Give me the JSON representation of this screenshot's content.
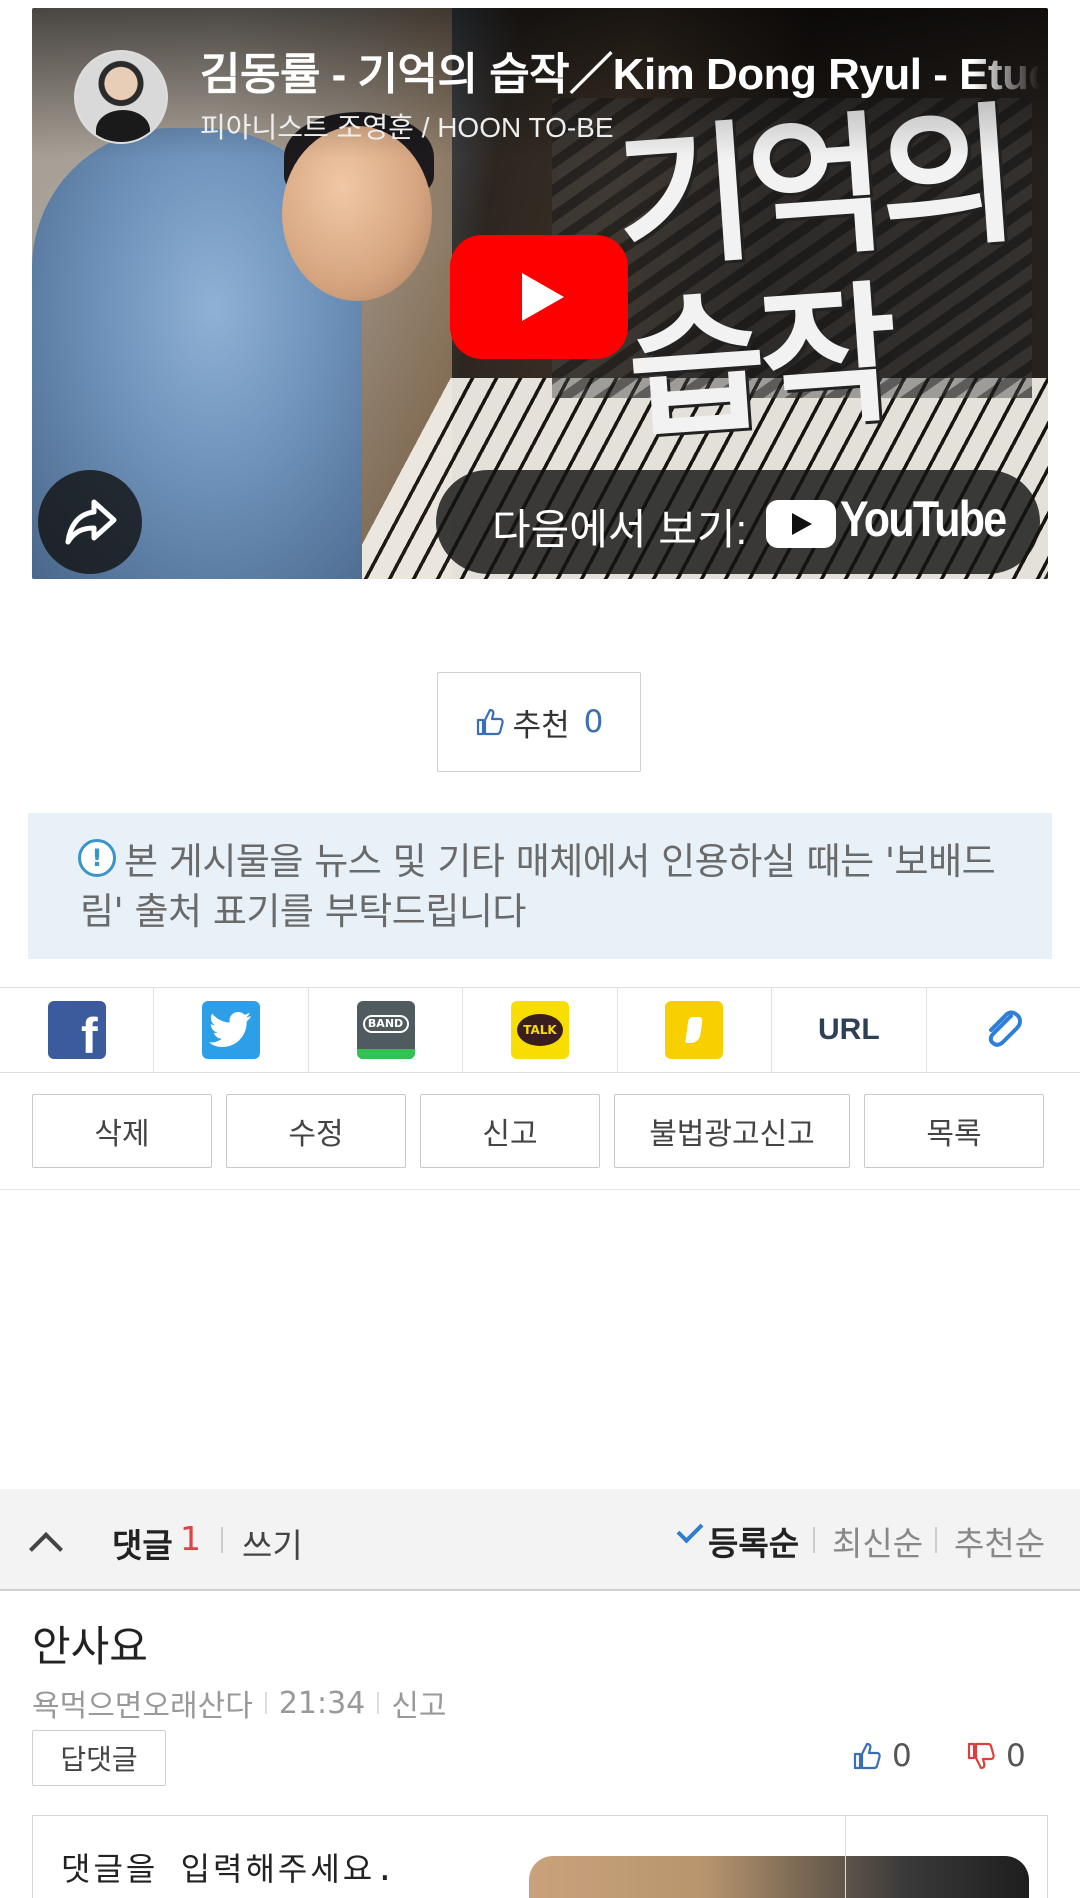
{
  "video": {
    "title": "김동률 - 기억의 습작／Kim Dong Ryul - Etude of Memories",
    "channel": "피아니스트 조영훈 / HOON TO-BE",
    "calligraphy": "기억의\n습작",
    "watch_on_label": "다음에서 보기:",
    "youtube_text": "YouTube",
    "icons": [
      "play-icon",
      "share-icon",
      "youtube-logo-icon"
    ]
  },
  "recommend": {
    "label": "추천",
    "count": "0"
  },
  "notice": {
    "text": "본 게시물을 뉴스 및 기타 매체에서 인용하실 때는 '보배드림' 출처 표기를 부탁드립니다"
  },
  "share": {
    "items": [
      {
        "name": "facebook",
        "icon": "facebook-icon",
        "color": "#3b5b9c"
      },
      {
        "name": "twitter",
        "icon": "twitter-icon",
        "color": "#2d9ee8"
      },
      {
        "name": "band",
        "icon": "band-icon",
        "label": "BAND"
      },
      {
        "name": "kakaotalk",
        "icon": "kakaotalk-icon",
        "label": "TALK"
      },
      {
        "name": "kakaostory",
        "icon": "kakaostory-icon"
      },
      {
        "name": "url",
        "label": "URL"
      },
      {
        "name": "attach",
        "icon": "paperclip-icon"
      }
    ]
  },
  "actions": {
    "delete": "삭제",
    "edit": "수정",
    "report": "신고",
    "illegal_ad_report": "불법광고신고",
    "list": "목록"
  },
  "comments": {
    "label": "댓글",
    "count": "1",
    "write": "쓰기",
    "sort": {
      "registered": "등록순",
      "latest": "최신순",
      "recommended": "추천순"
    },
    "items": [
      {
        "text": "안사요",
        "author": "욕먹으면오래산다",
        "time": "21:34",
        "report": "신고",
        "reply": "답댓글",
        "up": "0",
        "down": "0"
      }
    ],
    "input_placeholder": "댓글을 입력해주세요."
  },
  "colors": {
    "accent_blue": "#3a6fb6",
    "count_red": "#e04343",
    "notice_bg": "#e8f0f8",
    "youtube_red": "#ff0000"
  }
}
